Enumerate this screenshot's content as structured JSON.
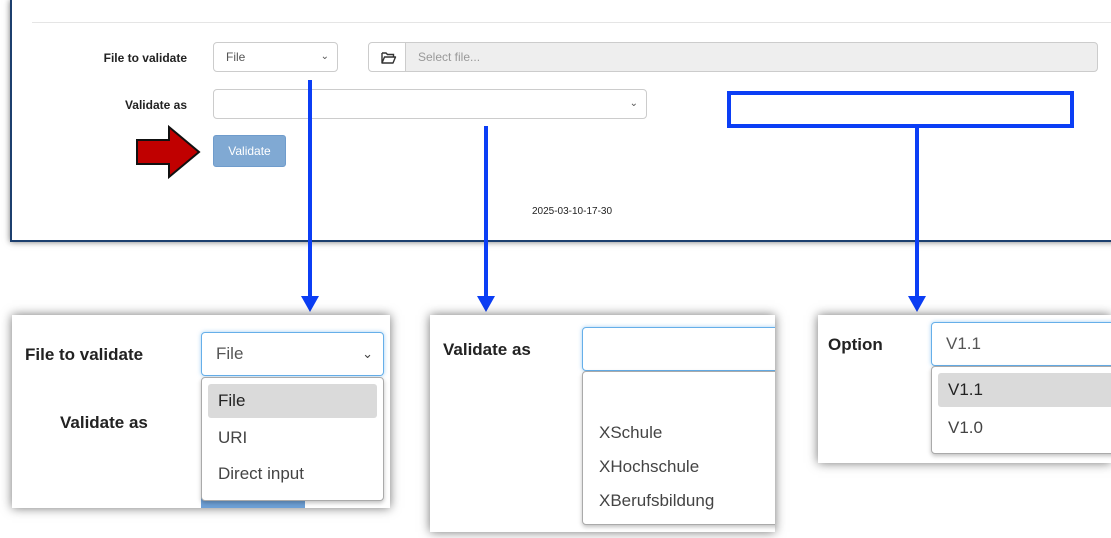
{
  "form": {
    "file_label": "File to validate",
    "file_type_selected": "File",
    "file_placeholder": "Select file...",
    "validate_as_label": "Validate as",
    "validate_as_selected": "",
    "validate_button": "Validate",
    "build_stamp": "2025-03-10-17-30"
  },
  "icons": {
    "chevron": "chevron-down-icon",
    "folder": "folder-open-icon",
    "arrow": "red-arrow-icon"
  },
  "zoom_file": {
    "label": "File to validate",
    "selected": "File",
    "second_label": "Validate as",
    "options": [
      "File",
      "URI",
      "Direct input"
    ],
    "highlighted": "File"
  },
  "zoom_validate_as": {
    "label": "Validate as",
    "selected": "",
    "options": [
      "",
      "XSchule",
      "XHochschule",
      "XBerufsbildung"
    ]
  },
  "zoom_option": {
    "label": "Option",
    "selected": "V1.1",
    "options": [
      "V1.1",
      "V1.0"
    ],
    "highlighted": "V1.1"
  },
  "colors": {
    "callout_blue": "#0b3ef5",
    "arrow_red": "#c00000",
    "button_blue": "#80a9d3",
    "panel_border": "#1c3f6e"
  }
}
